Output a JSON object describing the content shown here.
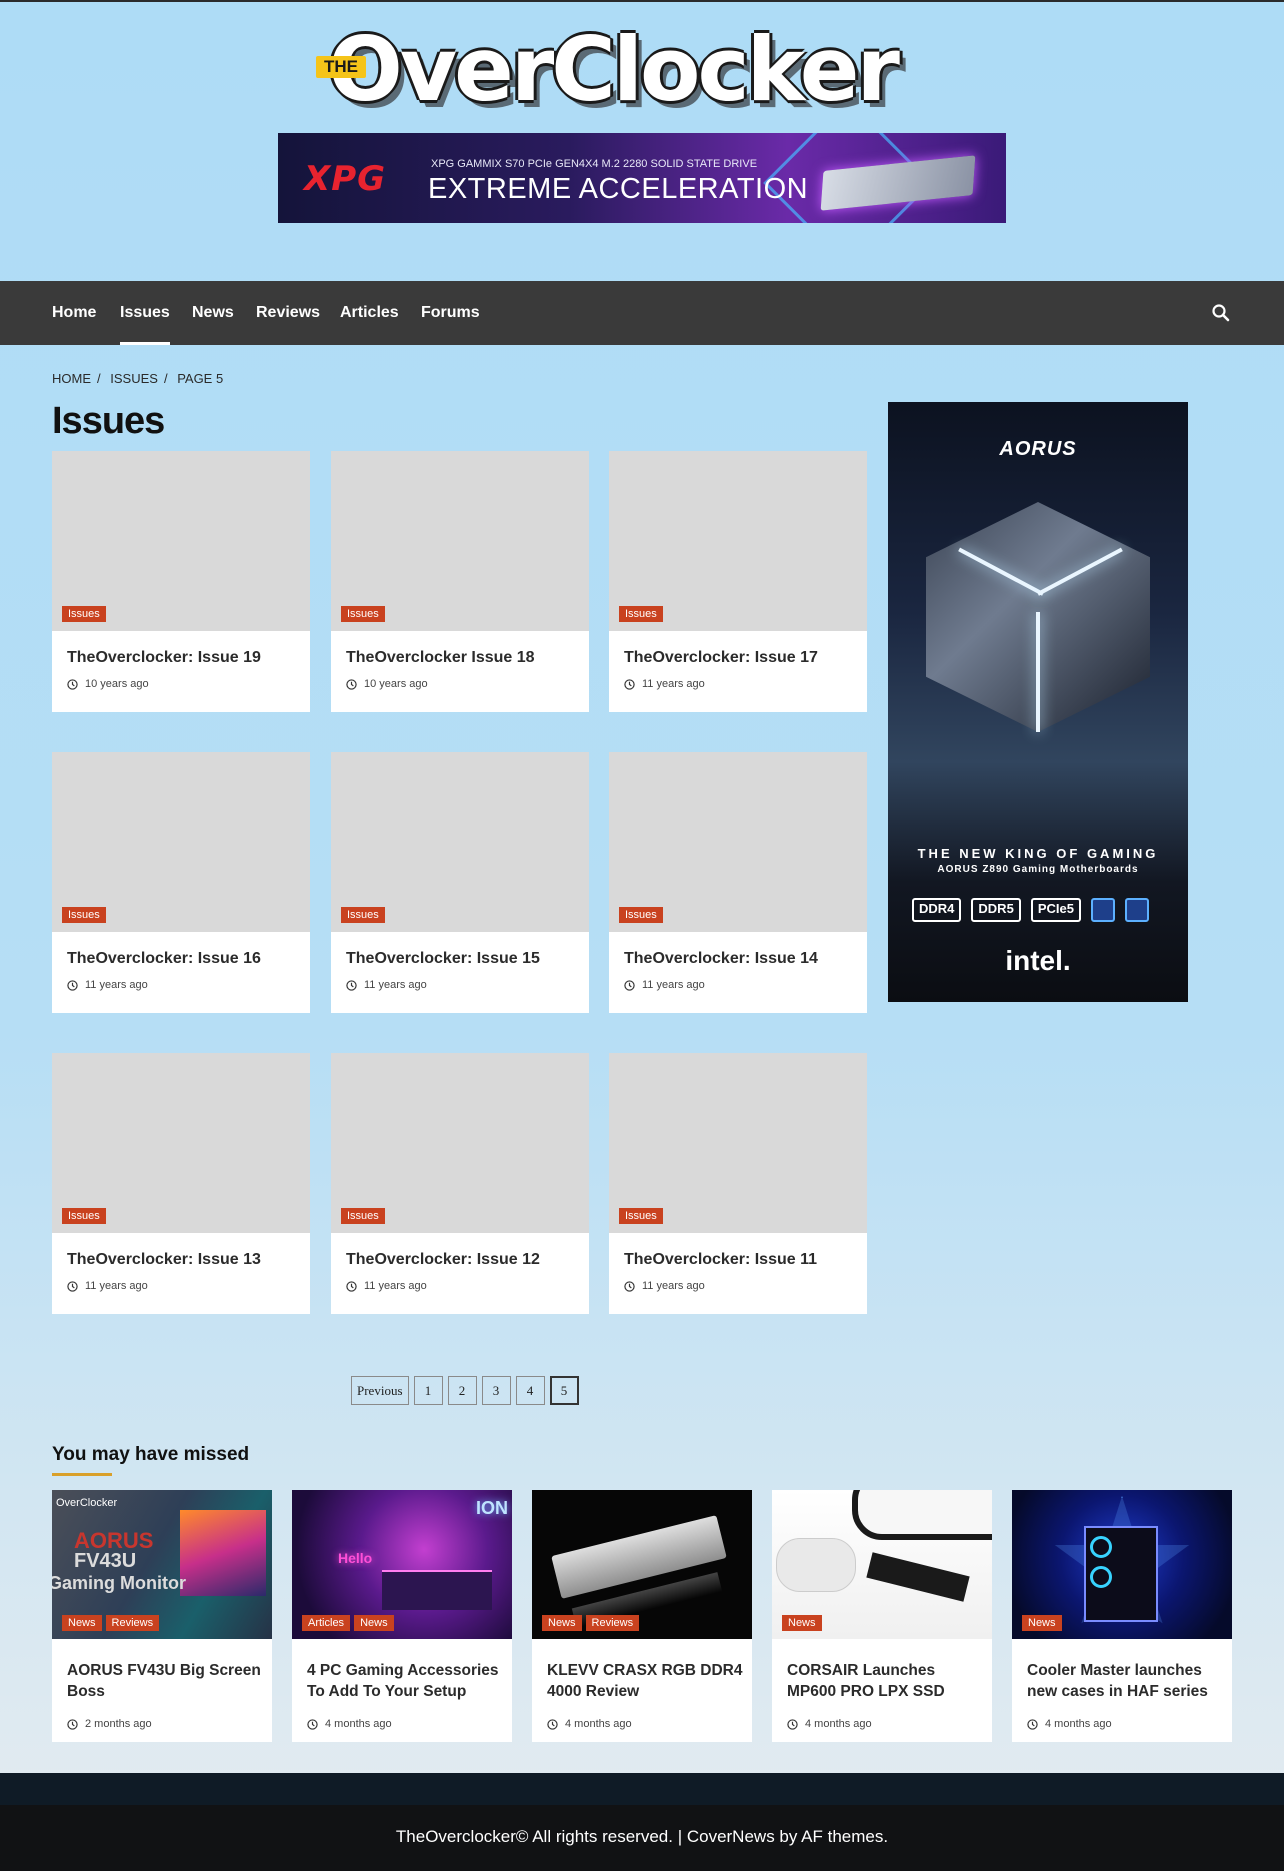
{
  "header": {
    "logo_small": "THE",
    "logo_text": "OverClocker",
    "banner": {
      "brand": "XPG",
      "small": "XPG GAMMIX S70 PCIe GEN4X4 M.2 2280 SOLID STATE DRIVE",
      "big": "EXTREME ACCELERATION"
    }
  },
  "nav": {
    "items": [
      {
        "label": "Home"
      },
      {
        "label": "Issues"
      },
      {
        "label": "News"
      },
      {
        "label": "Reviews"
      },
      {
        "label": "Articles"
      },
      {
        "label": "Forums"
      }
    ],
    "active": "Issues",
    "search_icon": "search-icon"
  },
  "breadcrumb": [
    "HOME",
    "ISSUES",
    "PAGE 5"
  ],
  "page_title": "Issues",
  "issues": [
    {
      "title": "TheOverclocker: Issue 19",
      "category": "Issues",
      "time": "10 years ago"
    },
    {
      "title": "TheOverclocker Issue 18",
      "category": "Issues",
      "time": "10 years ago"
    },
    {
      "title": "TheOverclocker: Issue 17",
      "category": "Issues",
      "time": "11 years ago"
    },
    {
      "title": "TheOverclocker: Issue 16",
      "category": "Issues",
      "time": "11 years ago"
    },
    {
      "title": "TheOverclocker: Issue 15",
      "category": "Issues",
      "time": "11 years ago"
    },
    {
      "title": "TheOverclocker: Issue 14",
      "category": "Issues",
      "time": "11 years ago"
    },
    {
      "title": "TheOverclocker: Issue 13",
      "category": "Issues",
      "time": "11 years ago"
    },
    {
      "title": "TheOverclocker: Issue 12",
      "category": "Issues",
      "time": "11 years ago"
    },
    {
      "title": "TheOverclocker: Issue 11",
      "category": "Issues",
      "time": "11 years ago"
    }
  ],
  "sidebar_ad": {
    "brand": "AORUS",
    "headline": "THE NEW KING OF GAMING",
    "subline": "AORUS Z890 Gaming Motherboards",
    "tags": [
      "DDR4",
      "DDR5",
      "PCIe5"
    ],
    "logo": "intel."
  },
  "pagination": {
    "previous": "Previous",
    "pages": [
      "1",
      "2",
      "3",
      "4",
      "5"
    ],
    "current": "5"
  },
  "missed": {
    "heading": "You may have missed",
    "items": [
      {
        "title": "AORUS FV43U Big Screen Boss",
        "categories": [
          "News",
          "Reviews"
        ],
        "time": "2 months ago",
        "image_text": {
          "site": "OverClocker",
          "line1": "AORUS",
          "line2": "FV43U",
          "line3": "Gaming Monitor"
        }
      },
      {
        "title": "4 PC Gaming Accessories To Add To Your Setup",
        "categories": [
          "Articles",
          "News"
        ],
        "time": "4 months ago",
        "image_text": {
          "sign": "Hello",
          "sign2": "ION"
        }
      },
      {
        "title": "KLEVV CRASX RGB DDR4 4000 Review",
        "categories": [
          "News",
          "Reviews"
        ],
        "time": "4 months ago"
      },
      {
        "title": "CORSAIR Launches MP600 PRO LPX SSD",
        "categories": [
          "News"
        ],
        "time": "4 months ago"
      },
      {
        "title": "Cooler Master launches new cases in HAF series",
        "categories": [
          "News"
        ],
        "time": "4 months ago"
      }
    ]
  },
  "footer": {
    "text": "TheOverclocker© All rights reserved. | CoverNews by AF themes."
  },
  "colors": {
    "accent_badge": "#c9421f",
    "nav_bg": "#3a3a3a",
    "footer_bg": "#111214",
    "page_bg": "#aedcf6",
    "underline": "#d9a02a"
  }
}
